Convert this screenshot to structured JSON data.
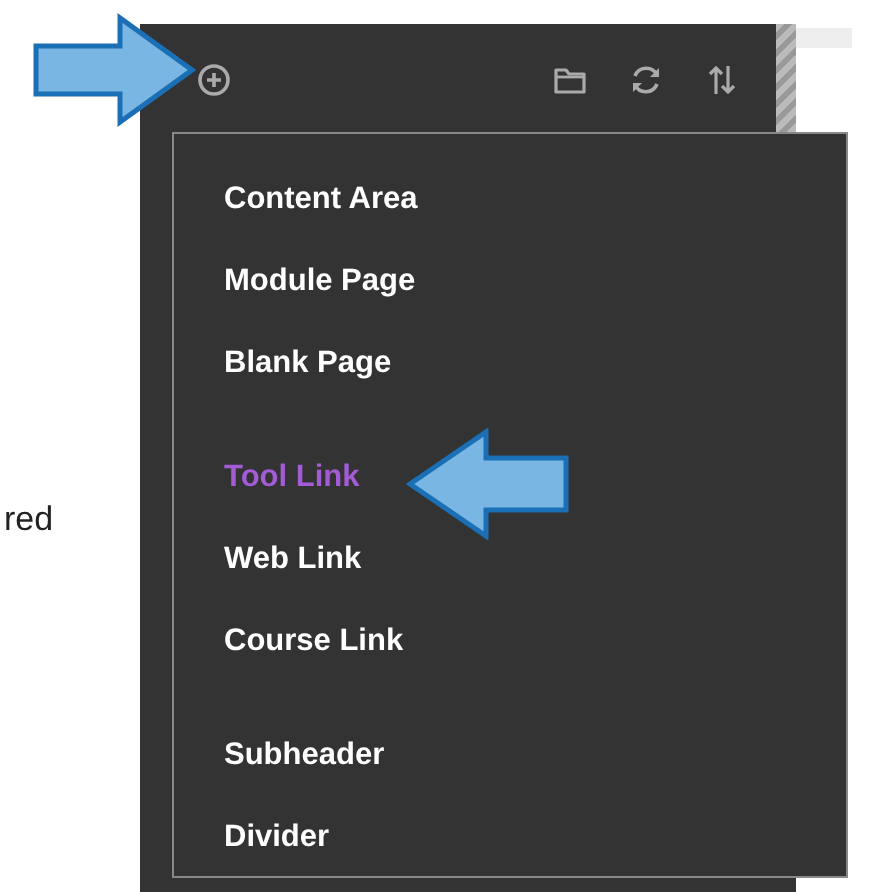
{
  "page_text": "red",
  "toolbar": {
    "icons": [
      {
        "kind": "add"
      },
      {
        "kind": "folder"
      },
      {
        "kind": "refresh"
      },
      {
        "kind": "sort"
      }
    ]
  },
  "menu": {
    "groups": [
      [
        {
          "label": "Content Area",
          "selected": false
        },
        {
          "label": "Module Page",
          "selected": false
        },
        {
          "label": "Blank Page",
          "selected": false
        }
      ],
      [
        {
          "label": "Tool Link",
          "selected": true
        },
        {
          "label": "Web Link",
          "selected": false
        },
        {
          "label": "Course Link",
          "selected": false
        }
      ],
      [
        {
          "label": "Subheader",
          "selected": false
        },
        {
          "label": "Divider",
          "selected": false
        }
      ]
    ]
  }
}
